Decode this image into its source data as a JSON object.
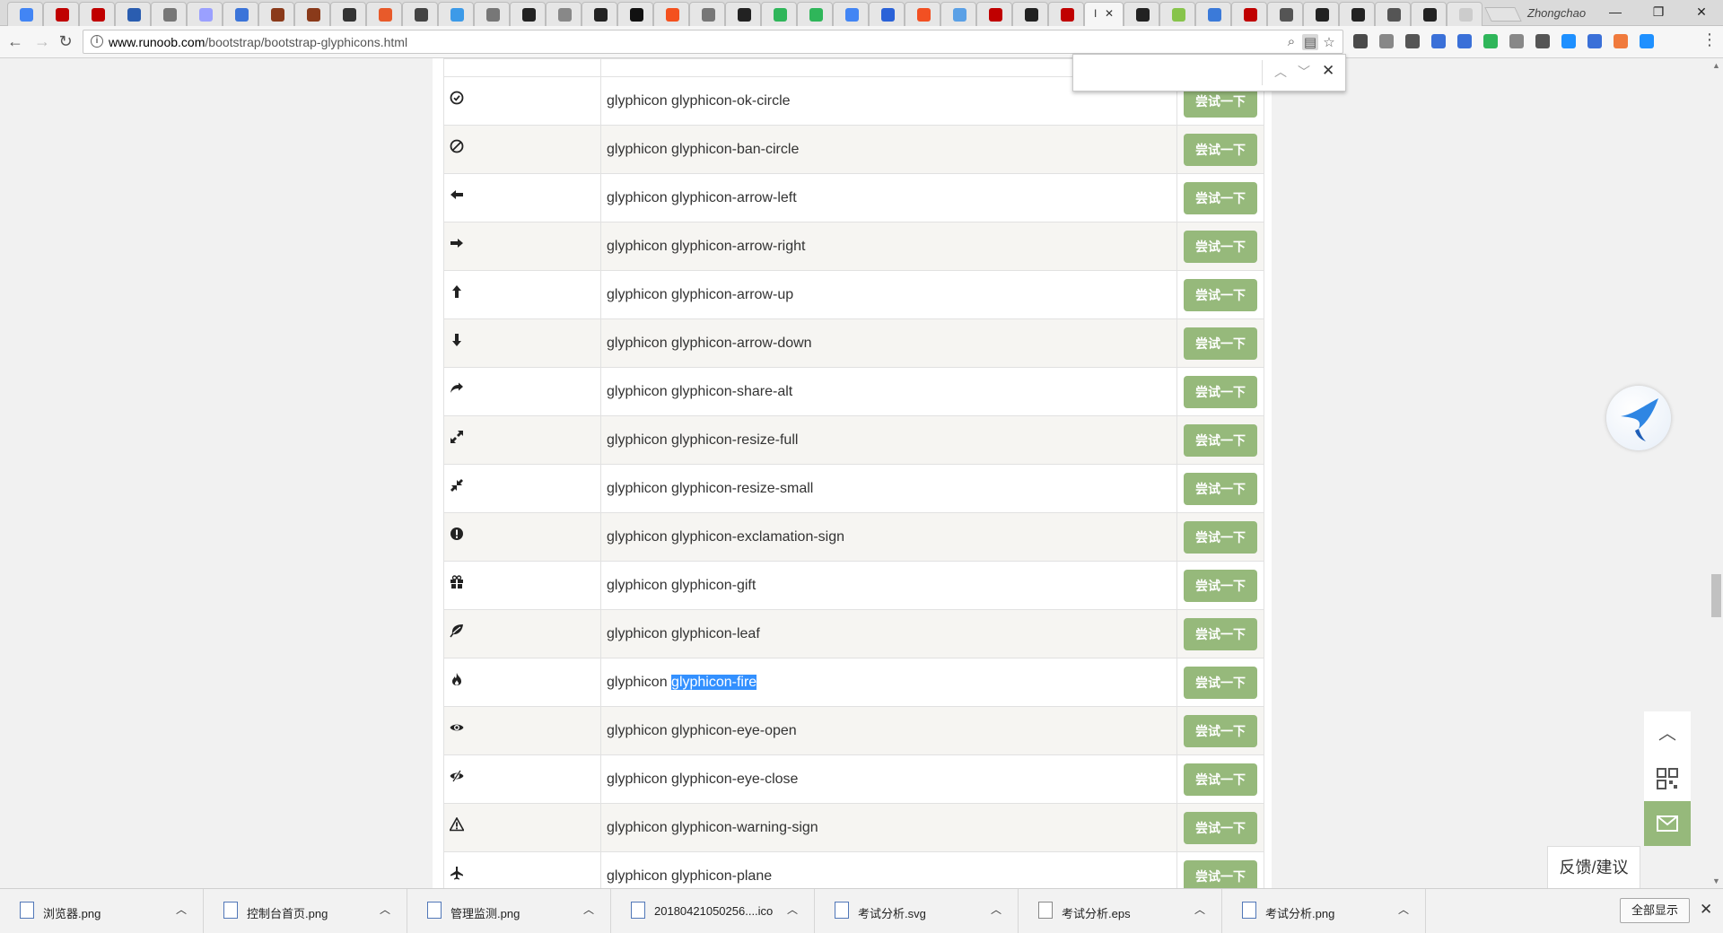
{
  "browser": {
    "user": "Zhongchao",
    "active_tab_text": "I",
    "tab_icon_colors": [
      "#4285f4",
      "#c00000",
      "#c00000",
      "#2a5db0",
      "#777777",
      "#9aa0ff",
      "#3b74d9",
      "#8a3a1a",
      "#8a3a1a",
      "#333333",
      "#e85a2a",
      "#444444",
      "#3c9ae8",
      "#777777",
      "#222222",
      "#888888",
      "#222222",
      "#111111",
      "#f4511e",
      "#777777",
      "#222222",
      "#2fb65a",
      "#2fb65a",
      "#4285f4",
      "#2a62d8",
      "#f25022",
      "#5aa0e6",
      "#c00000",
      "#222222",
      "#c00000"
    ],
    "tab_icon_colors_right": [
      "#222222",
      "#87c44b",
      "#3b7ad9",
      "#c00000",
      "#555555",
      "#222222",
      "#222222",
      "#555555",
      "#222222",
      "#cccccc"
    ],
    "url_host": "www.runoob.com",
    "url_path": "/bootstrap/bootstrap-glyphicons.html",
    "extension_colors": [
      "#4a4a4a",
      "#888888",
      "#555555",
      "#3a70d8",
      "#3a70d8",
      "#2fb65a",
      "#888888",
      "#555555",
      "#1e90ff",
      "#3a70d8",
      "#f07a3c",
      "#1e90ff"
    ]
  },
  "find": {
    "query": "",
    "prev": "^",
    "next": "v",
    "close": "✕"
  },
  "glyphs": {
    "button_label": "尝试一下",
    "rows": [
      {
        "prefix": "glyphicon ",
        "name": "glyphicon-ok-circle",
        "icon": "ok-circle-icon"
      },
      {
        "prefix": "glyphicon ",
        "name": "glyphicon-ban-circle",
        "icon": "ban-circle-icon"
      },
      {
        "prefix": "glyphicon ",
        "name": "glyphicon-arrow-left",
        "icon": "arrow-left-icon"
      },
      {
        "prefix": "glyphicon ",
        "name": "glyphicon-arrow-right",
        "icon": "arrow-right-icon"
      },
      {
        "prefix": "glyphicon ",
        "name": "glyphicon-arrow-up",
        "icon": "arrow-up-icon"
      },
      {
        "prefix": "glyphicon ",
        "name": "glyphicon-arrow-down",
        "icon": "arrow-down-icon"
      },
      {
        "prefix": "glyphicon ",
        "name": "glyphicon-share-alt",
        "icon": "share-alt-icon"
      },
      {
        "prefix": "glyphicon ",
        "name": "glyphicon-resize-full",
        "icon": "resize-full-icon"
      },
      {
        "prefix": "glyphicon ",
        "name": "glyphicon-resize-small",
        "icon": "resize-small-icon"
      },
      {
        "prefix": "glyphicon ",
        "name": "glyphicon-exclamation-sign",
        "icon": "exclamation-sign-icon"
      },
      {
        "prefix": "glyphicon ",
        "name": "glyphicon-gift",
        "icon": "gift-icon"
      },
      {
        "prefix": "glyphicon ",
        "name": "glyphicon-leaf",
        "icon": "leaf-icon"
      },
      {
        "prefix": "glyphicon ",
        "name": "glyphicon-fire",
        "icon": "fire-icon",
        "selected": true
      },
      {
        "prefix": "glyphicon ",
        "name": "glyphicon-eye-open",
        "icon": "eye-open-icon"
      },
      {
        "prefix": "glyphicon ",
        "name": "glyphicon-eye-close",
        "icon": "eye-close-icon"
      },
      {
        "prefix": "glyphicon ",
        "name": "glyphicon-warning-sign",
        "icon": "warning-sign-icon"
      },
      {
        "prefix": "glyphicon ",
        "name": "glyphicon-plane",
        "icon": "plane-icon"
      }
    ]
  },
  "side": {
    "feedback_label": "反馈/建议"
  },
  "downloads": {
    "items": [
      {
        "name": "浏览器.png"
      },
      {
        "name": "控制台首页.png"
      },
      {
        "name": "管理监测.png"
      },
      {
        "name": "20180421050256....ico"
      },
      {
        "name": "考试分析.svg"
      },
      {
        "name": "考试分析.eps"
      },
      {
        "name": "考试分析.png"
      }
    ],
    "show_all_label": "全部显示"
  }
}
